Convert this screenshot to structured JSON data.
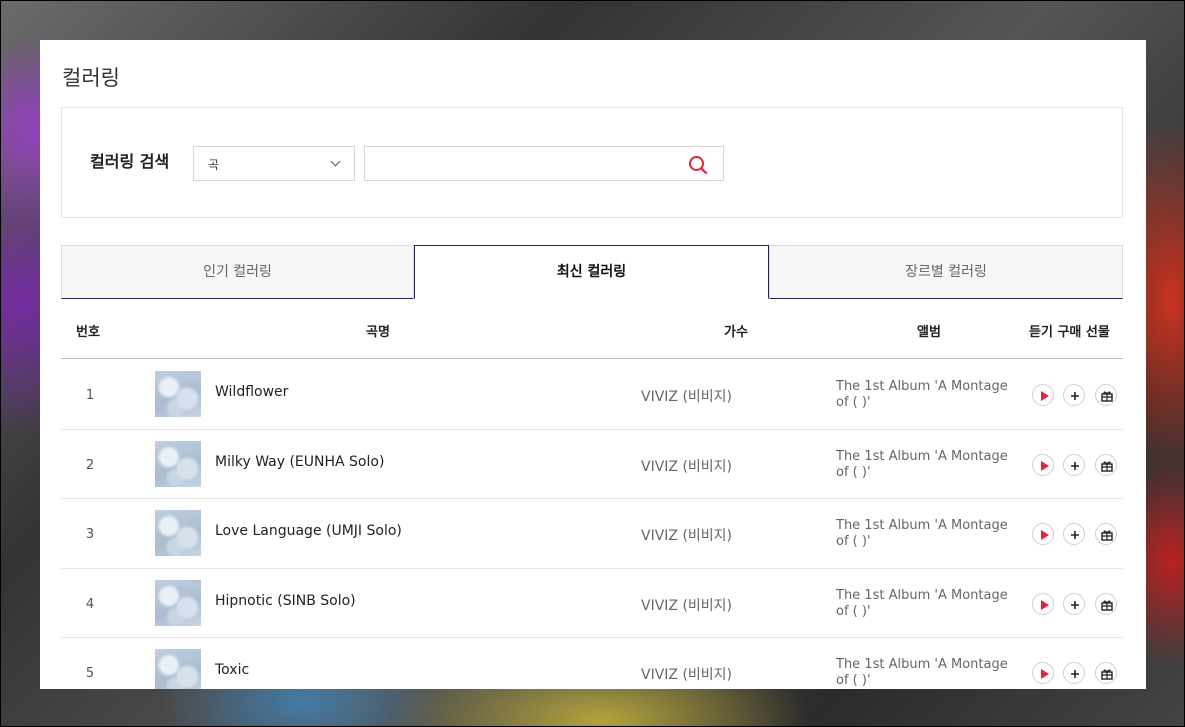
{
  "page": {
    "title": "컬러링"
  },
  "search": {
    "label": "컬러링 검색",
    "select_value": "곡",
    "input_value": "",
    "input_placeholder": ""
  },
  "tabs": [
    {
      "label": "인기 컬러링",
      "active": false
    },
    {
      "label": "최신 컬러링",
      "active": true
    },
    {
      "label": "장르별 컬러링",
      "active": false
    }
  ],
  "table": {
    "headers": {
      "num": "번호",
      "song": "곡명",
      "artist": "가수",
      "album": "앨범",
      "actions": "듣기 구매 선물"
    },
    "rows": [
      {
        "num": "1",
        "song": "Wildflower",
        "artist": "VIVIZ (비비지)",
        "album": "The 1st Album 'A Montage of ( )'"
      },
      {
        "num": "2",
        "song": "Milky Way (EUNHA Solo)",
        "artist": "VIVIZ (비비지)",
        "album": "The 1st Album 'A Montage of ( )'"
      },
      {
        "num": "3",
        "song": "Love Language (UMJI Solo)",
        "artist": "VIVIZ (비비지)",
        "album": "The 1st Album 'A Montage of ( )'"
      },
      {
        "num": "4",
        "song": "Hipnotic (SINB Solo)",
        "artist": "VIVIZ (비비지)",
        "album": "The 1st Album 'A Montage of ( )'"
      },
      {
        "num": "5",
        "song": "Toxic",
        "artist": "VIVIZ (비비지)",
        "album": "The 1st Album 'A Montage of ( )'"
      }
    ]
  },
  "icons": {
    "search": "search-icon",
    "play": "play-icon",
    "add": "plus-icon",
    "gift": "gift-icon",
    "dropdown": "chevron-down-icon"
  },
  "colors": {
    "accent": "#e8213a",
    "tab_border": "#23244d"
  }
}
